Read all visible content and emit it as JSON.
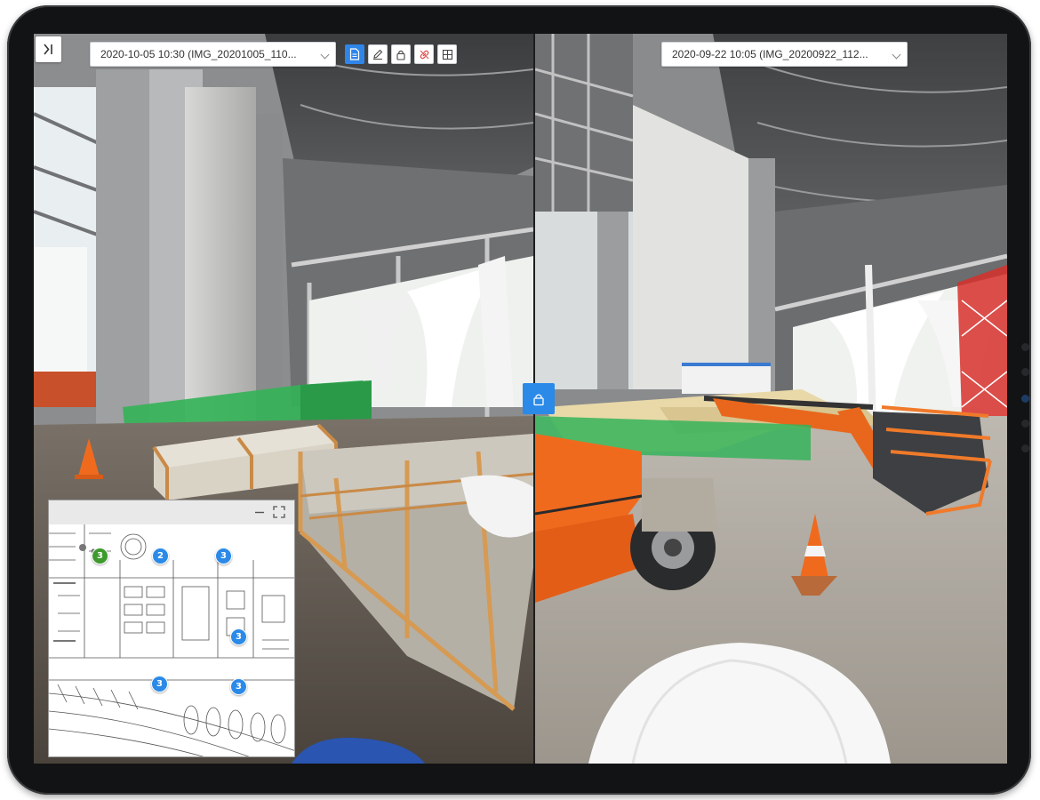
{
  "left_pane": {
    "date_select": {
      "value": "2020-10-05 10:30 (IMG_20201005_110..."
    },
    "toolbar": {
      "icons": [
        "document-icon",
        "pencil-icon",
        "lock-icon",
        "link-off-icon",
        "compare-icon"
      ],
      "active": "document-icon"
    },
    "collapse_icon": "collapse-panel-icon"
  },
  "right_pane": {
    "date_select": {
      "value": "2020-09-22 10:05 (IMG_20200922_112..."
    },
    "lock_icon": "lock-icon"
  },
  "minimap": {
    "controls": [
      "minimize-icon",
      "fullscreen-icon"
    ],
    "markers": [
      {
        "label": "3",
        "color": "#3f9a2e",
        "kind": "current"
      },
      {
        "label": "2",
        "color": "#2b8ae8",
        "kind": "capture"
      },
      {
        "label": "3",
        "color": "#2b8ae8",
        "kind": "capture"
      },
      {
        "label": "3",
        "color": "#2b8ae8",
        "kind": "capture"
      },
      {
        "label": "3",
        "color": "#2b8ae8",
        "kind": "capture"
      },
      {
        "label": "3",
        "color": "#2b8ae8",
        "kind": "capture"
      }
    ]
  },
  "colors": {
    "accent": "#2b8ae8",
    "current_marker": "#3f9a2e",
    "lift_orange": "#e8671c"
  }
}
